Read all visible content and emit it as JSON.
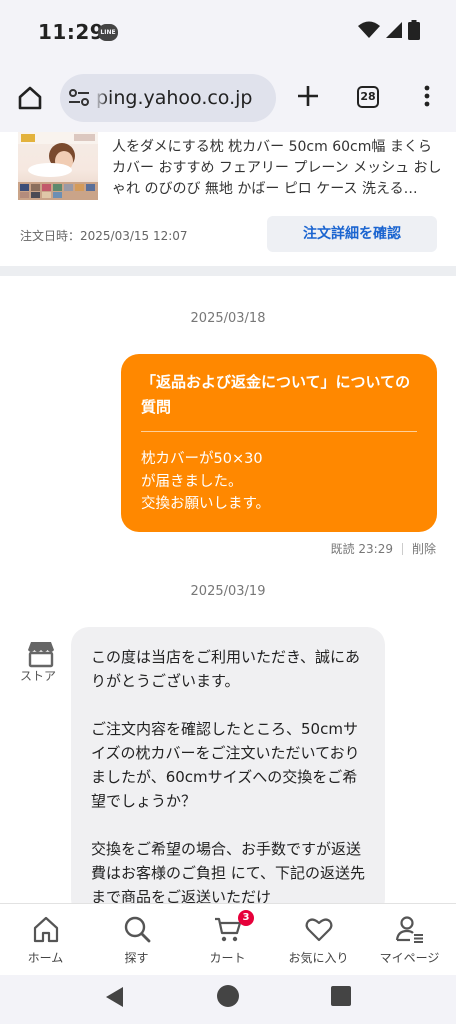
{
  "status_bar": {
    "time": "11:29",
    "notification_app": "LINE"
  },
  "browser": {
    "url_display": "ping.yahoo.co.jp",
    "tab_count": "28"
  },
  "order": {
    "title": "人をダメにする枕 枕カバー 50cm 60cm幅 まくらカバー おすすめ フェアリー プレーン メッシュ おしゃれ のびのび 無地 かばー ピロ ケース 洗える…",
    "order_date": "注文日時：2025/03/15 12:07",
    "detail_button": "注文詳細を確認"
  },
  "chat": {
    "date_1": "2025/03/18",
    "outgoing": {
      "title": "「返品および返金について」についての質問",
      "body": "枕カバーが50×30\nが届きました。\n交換お願いします。",
      "read_status": "既読 23:29",
      "delete_label": "削除"
    },
    "date_2": "2025/03/19",
    "store_label": "ストア",
    "incoming": {
      "body": "この度は当店をご利用いただき、誠にありがとうございます。\n\nご注文内容を確認したところ、50cmサイズの枕カバーをご注文いただいておりましたが、60cmサイズへの交換をご希望でしょうか？\n\n交換をご希望の場合、お手数ですが返送費はお客様のご負担 にて、下記の返送先まで商品をご返送いただけ"
    }
  },
  "bottom_nav": {
    "items": [
      {
        "label": "ホーム",
        "icon": "home-icon"
      },
      {
        "label": "探す",
        "icon": "search-icon"
      },
      {
        "label": "カート",
        "icon": "cart-icon",
        "badge": "3"
      },
      {
        "label": "お気に入り",
        "icon": "heart-icon"
      },
      {
        "label": "マイページ",
        "icon": "person-icon"
      }
    ]
  },
  "colors": {
    "accent_orange": "#ff8800",
    "link_blue": "#1a64d0",
    "badge_red": "#e6003a"
  }
}
